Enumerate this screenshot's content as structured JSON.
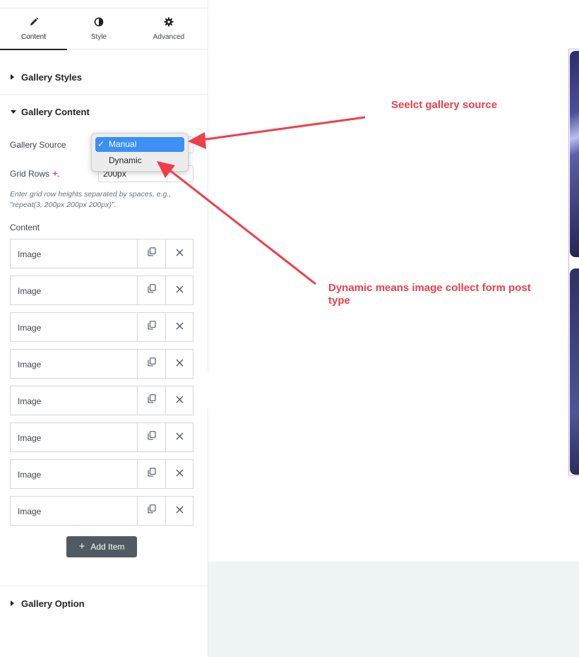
{
  "tabs": [
    {
      "label": "Content",
      "icon": "pencil-icon",
      "active": true
    },
    {
      "label": "Style",
      "icon": "half-circle-icon",
      "active": false
    },
    {
      "label": "Advanced",
      "icon": "gear-icon",
      "active": false
    }
  ],
  "sections": {
    "gallery_styles": "Gallery Styles",
    "gallery_content": "Gallery Content",
    "gallery_option": "Gallery Option"
  },
  "controls": {
    "gallery_source_label": "Gallery Source",
    "gallery_source_options": [
      "Manual",
      "Dynamic"
    ],
    "gallery_source_selected": "Manual",
    "check_mark": "✓",
    "grid_rows_label": "Grid Rows",
    "grid_rows_value": "200px",
    "grid_rows_help": "Enter grid row heights separated by spaces, e.g., \"repeat(3, 200px 200px 200px)\".",
    "content_label": "Content"
  },
  "items": [
    {
      "title": "Image"
    },
    {
      "title": "Image"
    },
    {
      "title": "Image"
    },
    {
      "title": "Image"
    },
    {
      "title": "Image"
    },
    {
      "title": "Image"
    },
    {
      "title": "Image"
    },
    {
      "title": "Image"
    }
  ],
  "add_item": {
    "plus": "+",
    "label": "Add Item"
  },
  "annotations": {
    "select_source": "Seelct gallery source",
    "dynamic_note": "Dynamic means image collect form post type",
    "color": "#ef3e4a"
  },
  "colors": {
    "accent_select": "#3b8ff5",
    "button_bg": "#515962",
    "preview_bottom": "#eef3f6"
  }
}
